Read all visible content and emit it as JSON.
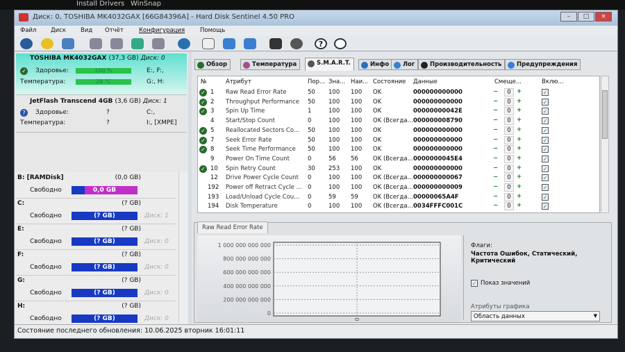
{
  "taskbar": {
    "items": [
      "Install Drivers",
      "WinSnap"
    ]
  },
  "window": {
    "title": "Диск: 0, TOSHIBA MK4032GAX [66G84396A]  -  Hard Disk Sentinel 4.50 PRO"
  },
  "menu": [
    "Файл",
    "Диск",
    "Вид",
    "Отчёт",
    "Конфигурация",
    "Помощь"
  ],
  "disks": [
    {
      "name": "TOSHIBA MK4032GAX",
      "size": "(37,3 GB)",
      "disk": "Диск: 0",
      "health_label": "Здоровье:",
      "health": "100 %",
      "health_pct": 100,
      "health_drives": "E:, F:,",
      "temp_label": "Температура:",
      "temp": "28 °C",
      "temp_drives": "G:, H:"
    },
    {
      "name": "JetFlash Transcend 4GB",
      "size": "(3,6 GB)",
      "disk": "Диск: 1",
      "health_label": "Здоровье:",
      "health": "?",
      "health_drives": "C:,",
      "temp_label": "Температура:",
      "temp": "?",
      "temp_drives": "I:, [XMPE]"
    }
  ],
  "volumes": [
    {
      "letter": "B: [RAMDisk]",
      "size": "(0,0 GB)",
      "free_label": "Свободно",
      "free": "0,0 GB",
      "disk": ""
    },
    {
      "letter": "C:",
      "size": "(? GB)",
      "free_label": "Свободно",
      "free": "(? GB)",
      "disk": "Диск: 1"
    },
    {
      "letter": "E:",
      "size": "(? GB)",
      "free_label": "Свободно",
      "free": "(? GB)",
      "disk": "Диск: 0"
    },
    {
      "letter": "F:",
      "size": "(? GB)",
      "free_label": "Свободно",
      "free": "(? GB)",
      "disk": "Диск: 0"
    },
    {
      "letter": "G:",
      "size": "(? GB)",
      "free_label": "Свободно",
      "free": "(? GB)",
      "disk": "Диск: 0"
    },
    {
      "letter": "H:",
      "size": "(? GB)",
      "free_label": "Свободно",
      "free": "(? GB)",
      "disk": "Диск: 0"
    }
  ],
  "tabs": [
    "Обзор",
    "Температура",
    "S.M.A.R.T.",
    "Инфо",
    "Лог",
    "Производительность",
    "Предупреждения"
  ],
  "smart": {
    "headers": [
      "№",
      "Атрибут",
      "Пор...",
      "Зна...",
      "Наи...",
      "Состояние",
      "Данные",
      "Смеще...",
      "Вклю..."
    ],
    "rows": [
      {
        "ok": true,
        "no": "1",
        "attr": "Raw Read Error Rate",
        "thr": "50",
        "val": "100",
        "worst": "100",
        "state": "OK",
        "data": "000000000000",
        "offset": "0"
      },
      {
        "ok": true,
        "no": "2",
        "attr": "Throughput Performance",
        "thr": "50",
        "val": "100",
        "worst": "100",
        "state": "OK",
        "data": "000000000000",
        "offset": "0"
      },
      {
        "ok": true,
        "no": "3",
        "attr": "Spin Up Time",
        "thr": "1",
        "val": "100",
        "worst": "100",
        "state": "OK",
        "data": "00000000042E",
        "offset": "0"
      },
      {
        "ok": false,
        "no": "4",
        "attr": "Start/Stop Count",
        "thr": "0",
        "val": "100",
        "worst": "100",
        "state": "OK (Всегда...",
        "data": "000000008790",
        "offset": "0"
      },
      {
        "ok": true,
        "no": "5",
        "attr": "Reallocated Sectors Co...",
        "thr": "50",
        "val": "100",
        "worst": "100",
        "state": "OK",
        "data": "000000000000",
        "offset": "0"
      },
      {
        "ok": true,
        "no": "7",
        "attr": "Seek Error Rate",
        "thr": "50",
        "val": "100",
        "worst": "100",
        "state": "OK",
        "data": "000000000000",
        "offset": "0"
      },
      {
        "ok": true,
        "no": "8",
        "attr": "Seek Time Performance",
        "thr": "50",
        "val": "100",
        "worst": "100",
        "state": "OK",
        "data": "000000000000",
        "offset": "0"
      },
      {
        "ok": false,
        "no": "9",
        "attr": "Power On Time Count",
        "thr": "0",
        "val": "56",
        "worst": "56",
        "state": "OK (Всегда...",
        "data": "0000000045E4",
        "offset": "0"
      },
      {
        "ok": true,
        "no": "10",
        "attr": "Spin Retry Count",
        "thr": "30",
        "val": "253",
        "worst": "100",
        "state": "OK",
        "data": "000000000000",
        "offset": "0"
      },
      {
        "ok": false,
        "no": "12",
        "attr": "Drive Power Cycle Count",
        "thr": "0",
        "val": "100",
        "worst": "100",
        "state": "OK (Всегда...",
        "data": "000000000067",
        "offset": "0"
      },
      {
        "ok": false,
        "no": "192",
        "attr": "Power off Retract Cycle ...",
        "thr": "0",
        "val": "100",
        "worst": "100",
        "state": "OK (Всегда...",
        "data": "000000000009",
        "offset": "0"
      },
      {
        "ok": false,
        "no": "193",
        "attr": "Load/Unload Cycle Cou...",
        "thr": "0",
        "val": "59",
        "worst": "59",
        "state": "OK (Всегда...",
        "data": "00000065A4F",
        "offset": "0"
      },
      {
        "ok": false,
        "no": "194",
        "attr": "Disk Temperature",
        "thr": "0",
        "val": "100",
        "worst": "100",
        "state": "OK (Всегда...",
        "data": "0034FFFC001C",
        "offset": "0"
      }
    ]
  },
  "chart_tab": "Raw Read Error Rate",
  "chart_data": {
    "type": "line",
    "title": "Raw Read Error Rate",
    "yticks": [
      "1 000 000 000 000",
      "800 000 000 000",
      "600 000 000 000",
      "400 000 000 000",
      "200 000 000 000",
      "0"
    ],
    "xticks": [
      "0"
    ],
    "ylim": [
      0,
      1000000000000
    ],
    "series": [],
    "grid": true
  },
  "flags": {
    "label": "Флаги:",
    "value": "Частота Ошибок, Статический, Критический"
  },
  "show_values": {
    "label": "Показ значений",
    "checked": true
  },
  "chart_attrs": {
    "label": "Атрибуты графика",
    "selected": "Область данных"
  },
  "status": "Состояние последнего обновления: 10.06.2025 вторник 16:01:11"
}
